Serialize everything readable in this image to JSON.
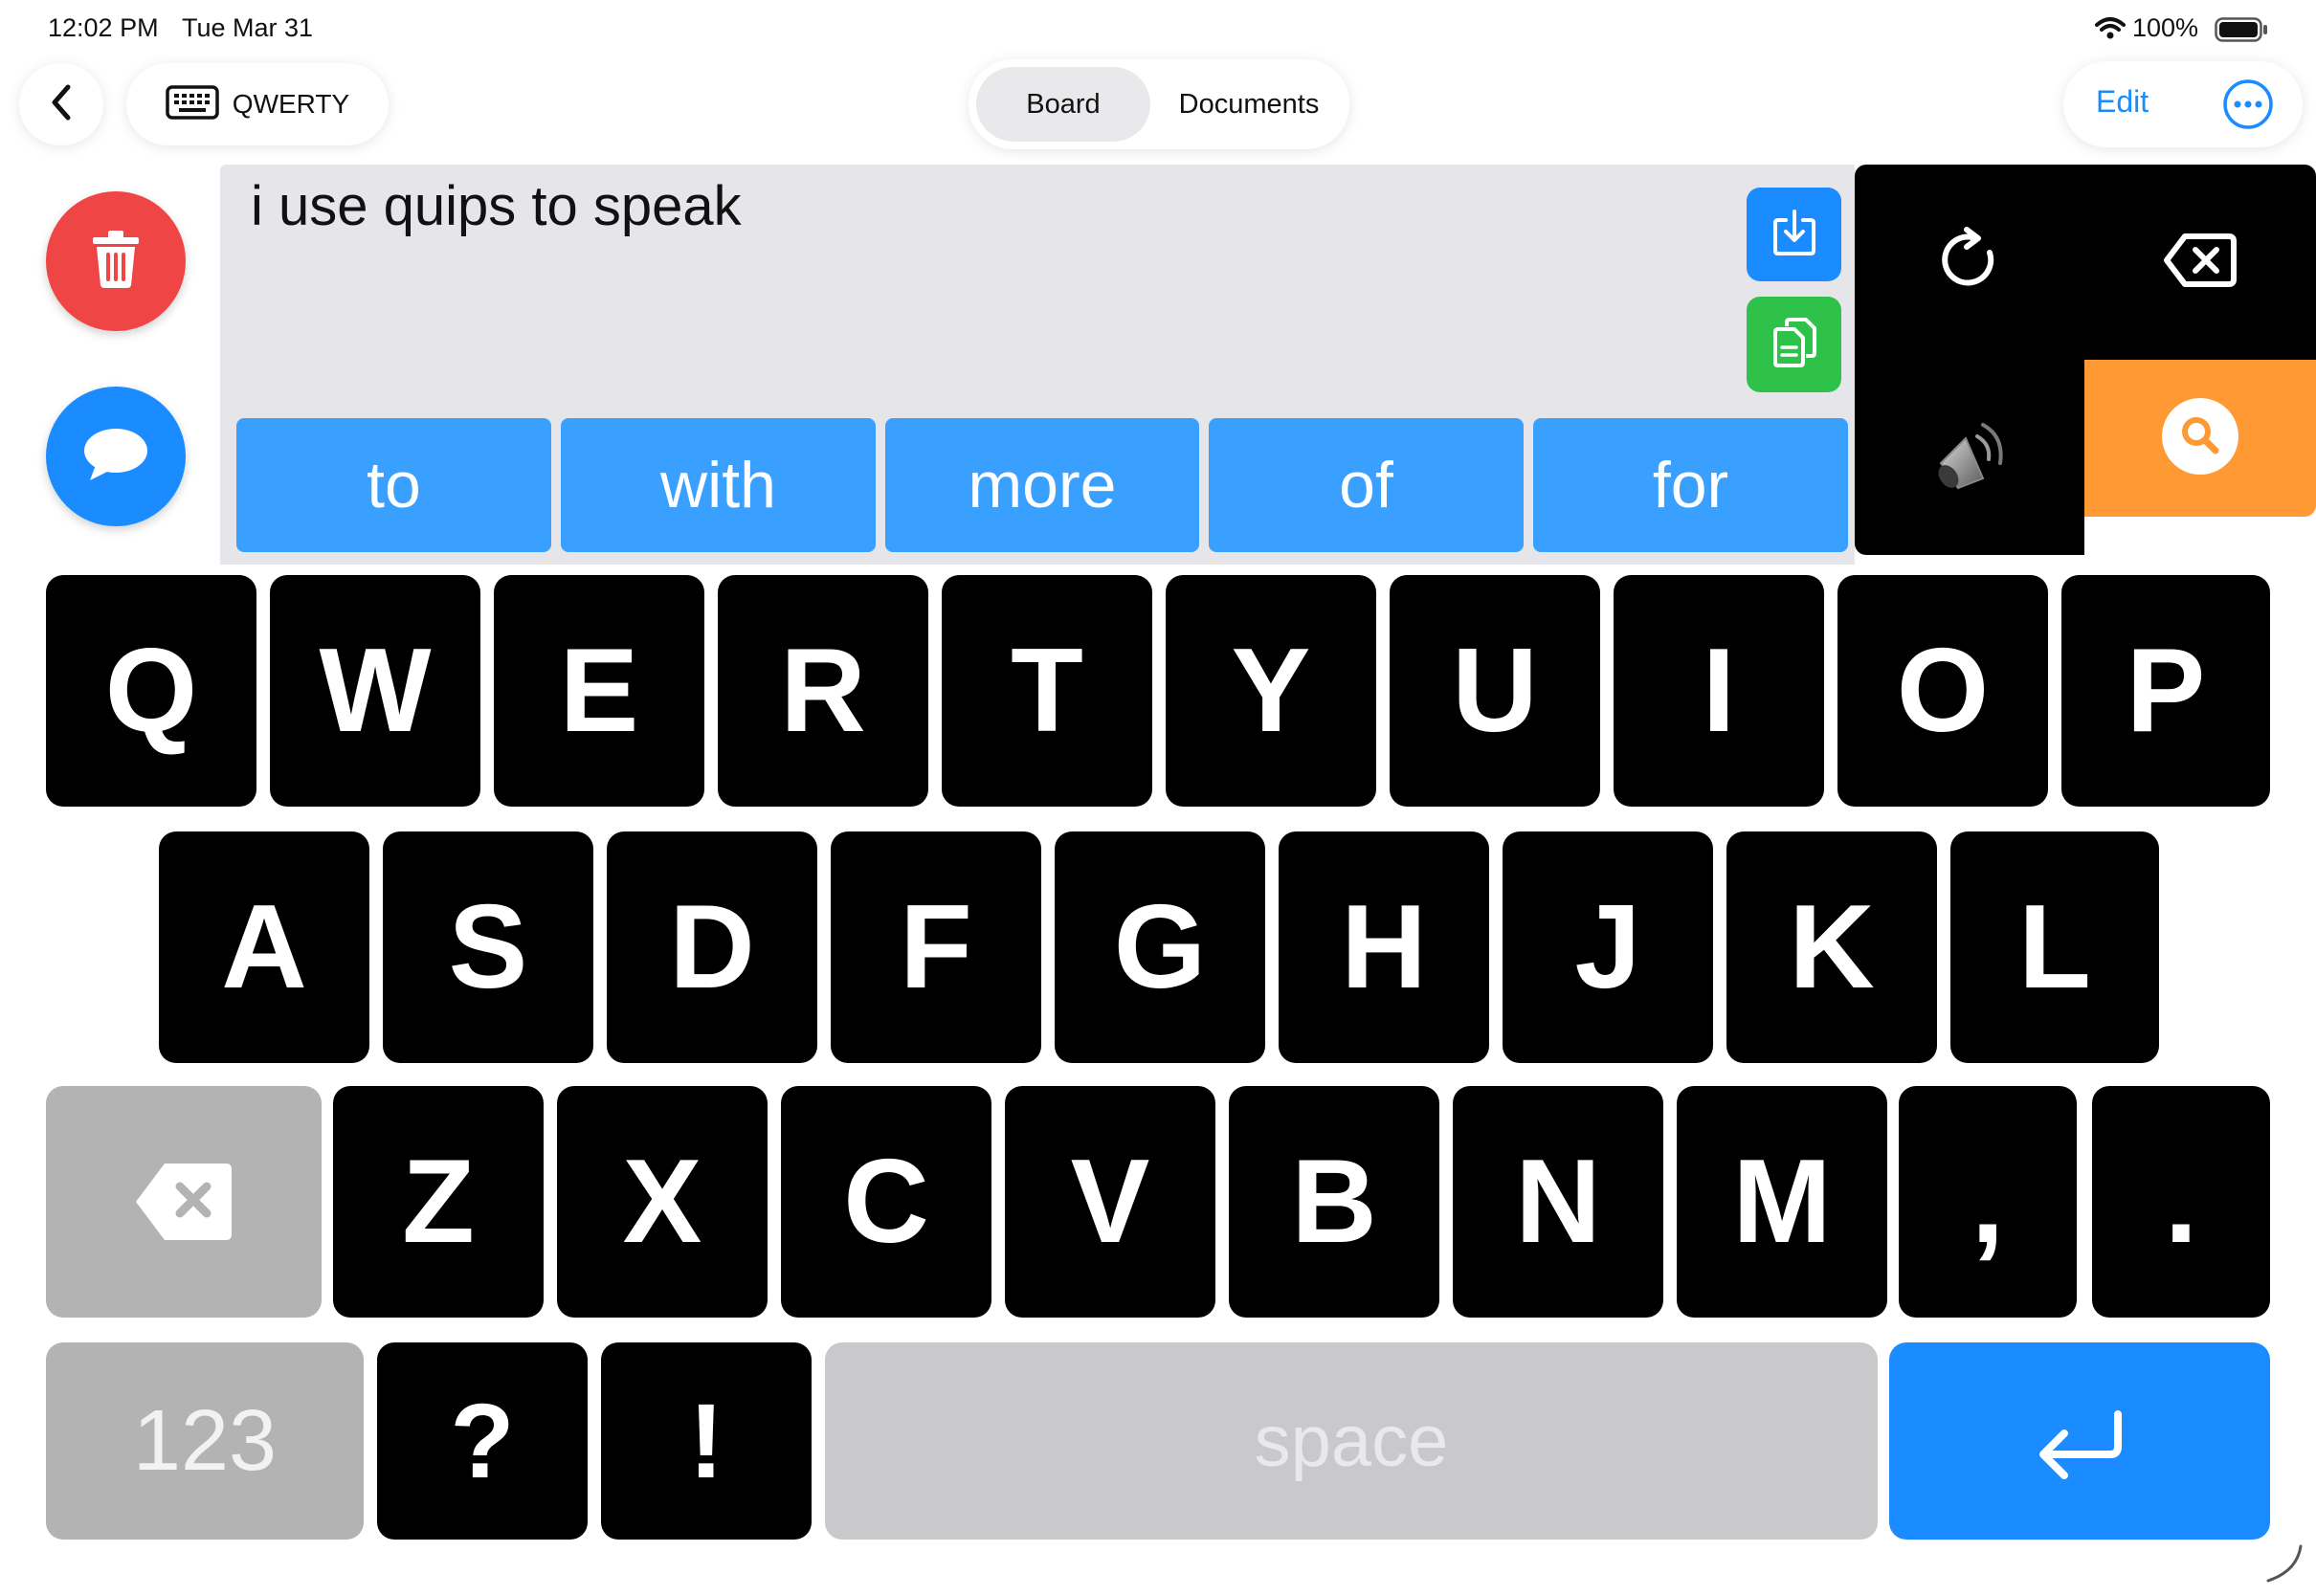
{
  "status_bar": {
    "time": "12:02 PM",
    "date": "Tue Mar 31",
    "battery": "100%"
  },
  "top_bar": {
    "board_name": "QWERTY",
    "tabs": [
      {
        "label": "Board",
        "active": true
      },
      {
        "label": "Documents",
        "active": false
      }
    ],
    "edit_label": "Edit"
  },
  "message": {
    "text": "i use quips to speak"
  },
  "predictions": [
    "to",
    "with",
    "more",
    "of",
    "for"
  ],
  "keyboard": {
    "row1": [
      "Q",
      "W",
      "E",
      "R",
      "T",
      "Y",
      "U",
      "I",
      "O",
      "P"
    ],
    "row2": [
      "A",
      "S",
      "D",
      "F",
      "G",
      "H",
      "J",
      "K",
      "L"
    ],
    "row3": [
      "Z",
      "X",
      "C",
      "V",
      "B",
      "N",
      "M",
      ",",
      "."
    ],
    "numbers_label": "123",
    "question_label": "?",
    "exclaim_label": "!",
    "space_label": "space"
  },
  "colors": {
    "accent_blue": "#1a8cff",
    "prediction_blue": "#3aa0ff",
    "delete_red": "#f04545",
    "copy_green": "#2ec24a",
    "search_orange": "#ff9933"
  },
  "icons": {
    "back": "chevron-left-icon",
    "keyboard": "keyboard-icon",
    "more": "ellipsis-circle-icon",
    "trash": "trash-icon",
    "chat": "speech-bubble-icon",
    "save": "save-download-icon",
    "copy": "copy-icon",
    "repeat": "repeat-icon",
    "backspace": "backspace-icon",
    "speaker": "speaker-icon",
    "search": "search-icon",
    "return": "return-icon"
  }
}
